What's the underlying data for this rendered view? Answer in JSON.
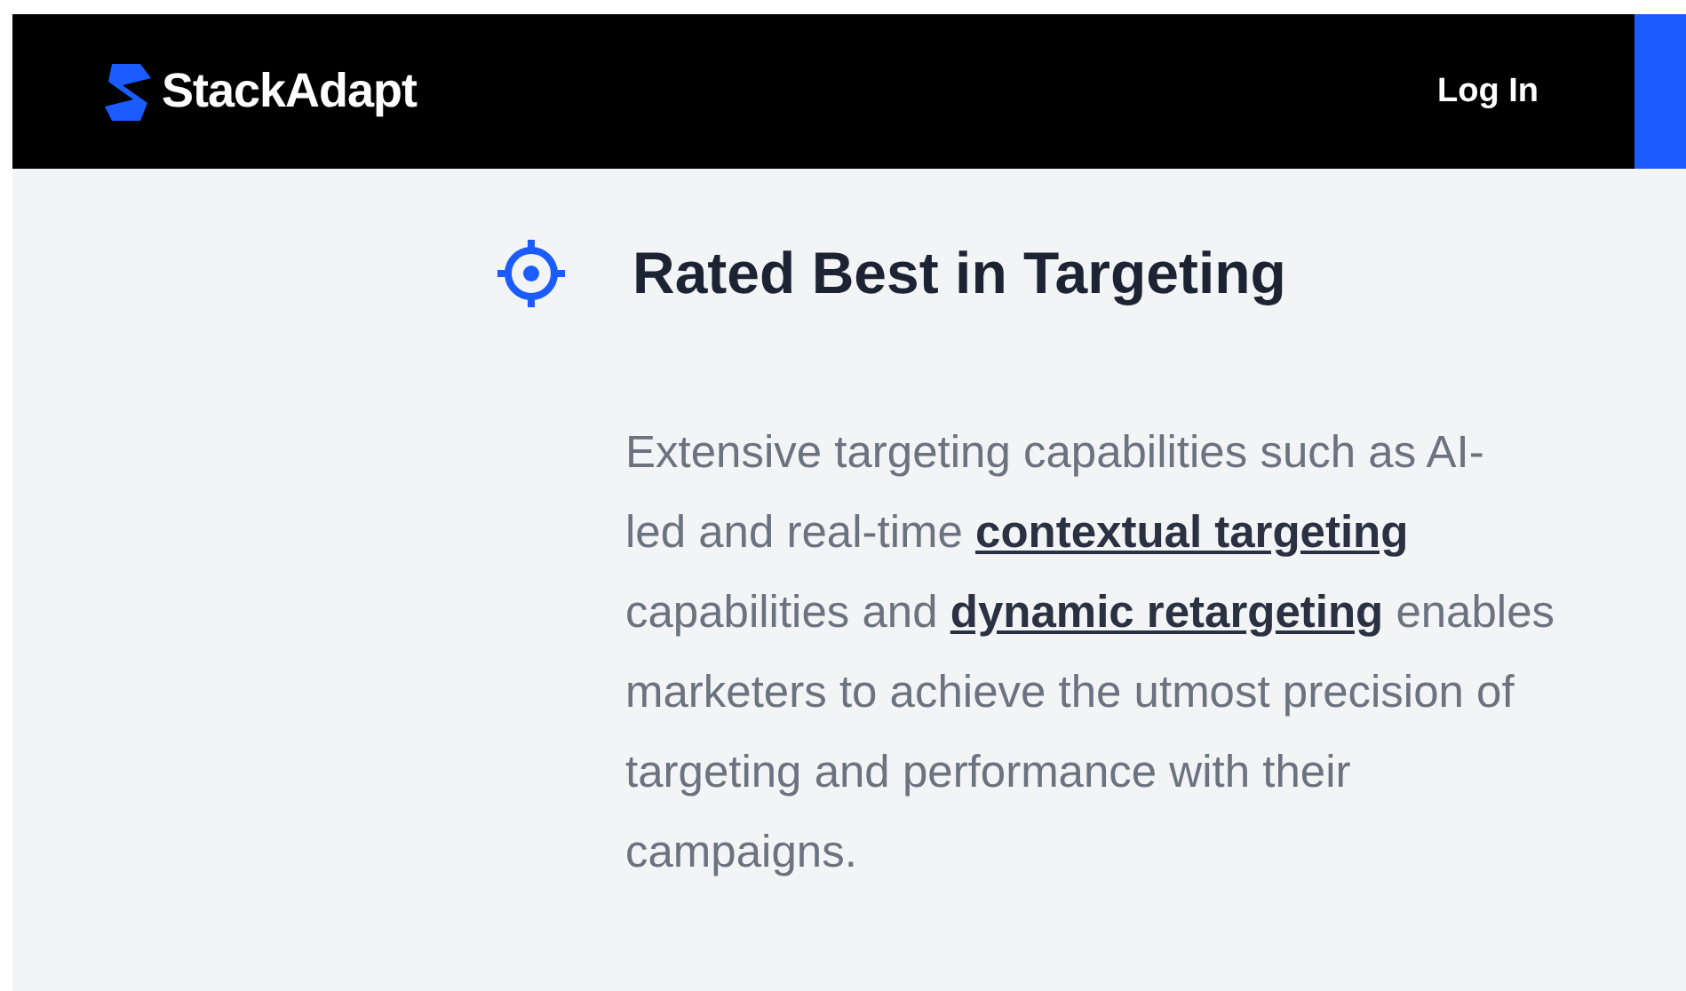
{
  "header": {
    "logo_text": "StackAdapt",
    "login": "Log In"
  },
  "feature": {
    "title": "Rated Best in Targeting",
    "lines": [
      [
        {
          "kind": "text",
          "text": "Extensive targeting capabilities such as AI-"
        }
      ],
      [
        {
          "kind": "text",
          "text": "led and real-time "
        },
        {
          "kind": "link",
          "text": "contextual targeting"
        }
      ],
      [
        {
          "kind": "text",
          "text": "capabilities and "
        },
        {
          "kind": "link",
          "text": "dynamic retargeting"
        },
        {
          "kind": "text",
          "text": " enables"
        }
      ],
      [
        {
          "kind": "text",
          "text": "marketers to achieve the utmost precision of"
        }
      ],
      [
        {
          "kind": "text",
          "text": "targeting and performance with their"
        }
      ],
      [
        {
          "kind": "text",
          "text": "campaigns."
        }
      ]
    ]
  }
}
